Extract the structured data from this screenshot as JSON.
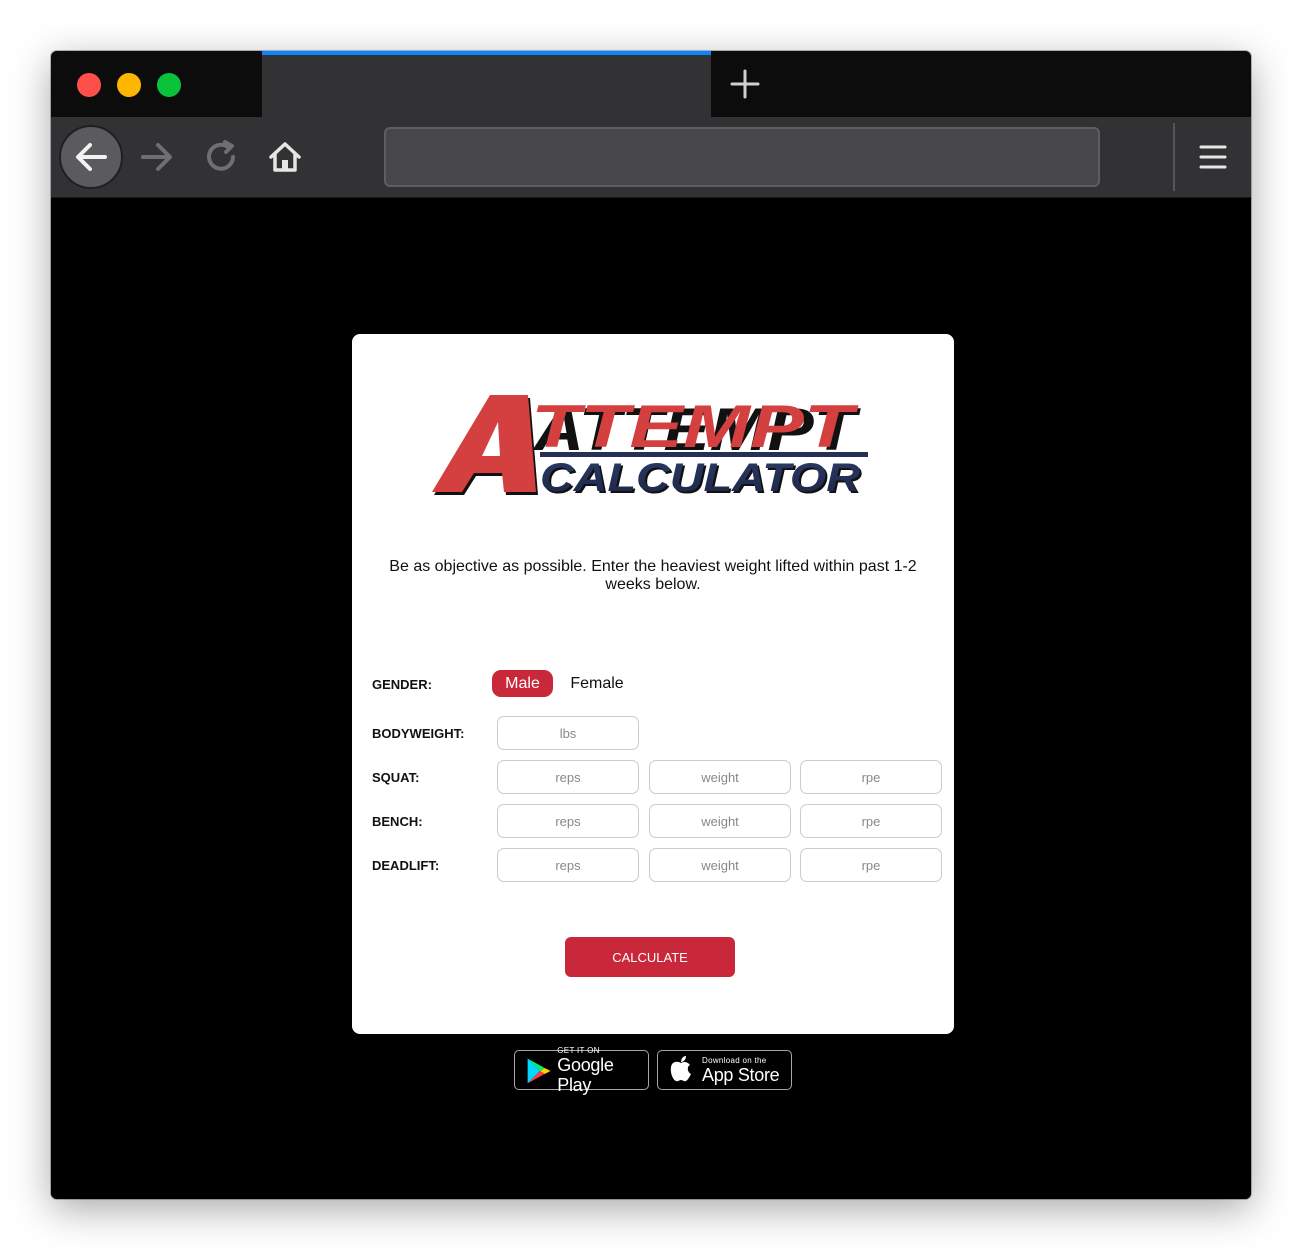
{
  "browser": {
    "tab_title": "",
    "url": "",
    "icons": {
      "back": "arrow-left-icon",
      "forward": "arrow-right-icon",
      "reload": "reload-icon",
      "home": "home-icon",
      "new_tab": "plus-icon",
      "menu": "hamburger-menu-icon"
    },
    "accent_color": "#0a84ff"
  },
  "logo": {
    "line1": "ATTEMPT",
    "line2": "CALCULATOR",
    "colors": {
      "red": "#d43f3f",
      "navy": "#243056"
    }
  },
  "intro_text": "Be as objective as possible. Enter the heaviest weight lifted within past 1-2 weeks below.",
  "form": {
    "gender_label": "GENDER:",
    "gender_options": [
      "Male",
      "Female"
    ],
    "gender_selected": "Male",
    "bodyweight_label": "BODYWEIGHT:",
    "bodyweight_placeholder": "lbs",
    "lifts": [
      {
        "label": "SQUAT:",
        "reps_placeholder": "reps",
        "weight_placeholder": "weight",
        "rpe_placeholder": "rpe"
      },
      {
        "label": "BENCH:",
        "reps_placeholder": "reps",
        "weight_placeholder": "weight",
        "rpe_placeholder": "rpe"
      },
      {
        "label": "DEADLIFT:",
        "reps_placeholder": "reps",
        "weight_placeholder": "weight",
        "rpe_placeholder": "rpe"
      }
    ],
    "calculate_label": "CALCULATE",
    "accent_color": "#c8283a"
  },
  "stores": {
    "google_play": {
      "small": "GET IT ON",
      "big": "Google Play"
    },
    "app_store": {
      "small": "Download on the",
      "big": "App Store"
    }
  }
}
